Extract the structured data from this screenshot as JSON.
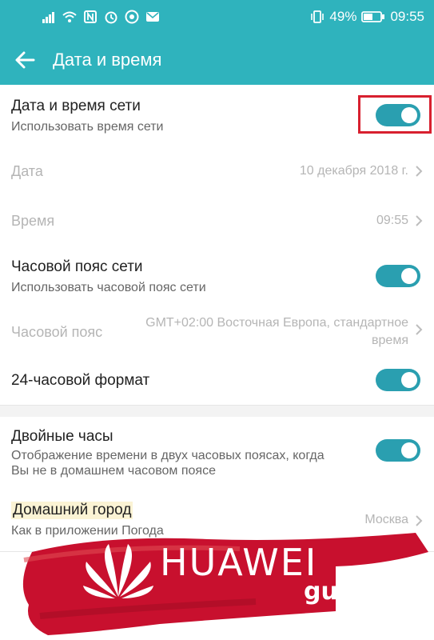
{
  "status": {
    "battery": "49%",
    "time": "09:55"
  },
  "appbar": {
    "title": "Дата и время"
  },
  "settings": {
    "network_time": {
      "title": "Дата и время сети",
      "subtitle": "Использовать время сети",
      "enabled": true
    },
    "date": {
      "label": "Дата",
      "value": "10 декабря 2018 г."
    },
    "time": {
      "label": "Время",
      "value": "09:55"
    },
    "network_timezone": {
      "title": "Часовой пояс сети",
      "subtitle": "Использовать часовой пояс сети",
      "enabled": true
    },
    "timezone": {
      "label": "Часовой пояс",
      "value_line1": "GMT+02:00 Восточная Европа, стандартное",
      "value_line2": "время"
    },
    "format24": {
      "title": "24-часовой формат",
      "enabled": true
    },
    "dual_clock": {
      "title": "Двойные часы",
      "subtitle_line1": "Отображение времени в двух часовых поясах, когда",
      "subtitle_line2": "Вы не в домашнем часовом поясе",
      "enabled": true
    },
    "home_city": {
      "title": "Домашний город",
      "subtitle": "Как в приложении Погода",
      "value": "Москва"
    }
  },
  "watermark": {
    "brand": "HUAWEI",
    "sub": "guide"
  },
  "colors": {
    "accent": "#2fb3bd",
    "toggle_on": "#2a9fb0",
    "highlight": "#d8202f",
    "brand_red": "#c8102e"
  }
}
